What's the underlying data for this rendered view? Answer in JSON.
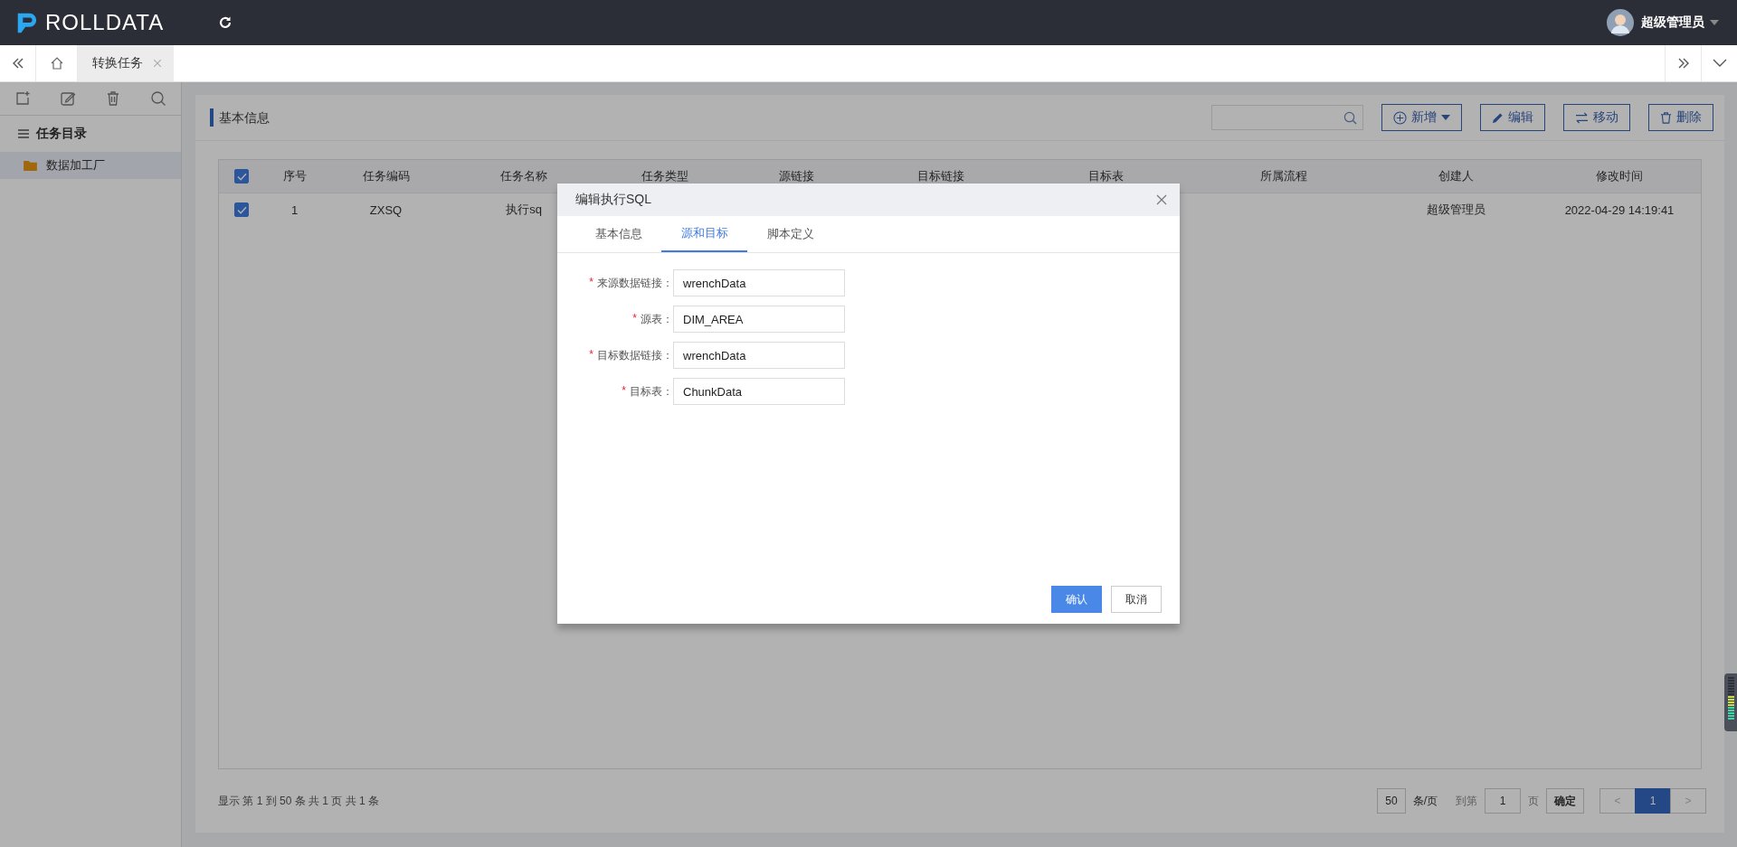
{
  "app": {
    "logo": "ROLLDATA",
    "user": "超级管理员"
  },
  "tabs": [
    {
      "label": "转换任务",
      "selected": true
    }
  ],
  "sidebar": {
    "title": "任务目录",
    "items": [
      {
        "label": "数据加工厂",
        "selected": true
      }
    ]
  },
  "panel": {
    "title": "基本信息",
    "buttons": [
      {
        "label": "新增",
        "kind": "add"
      },
      {
        "label": "编辑",
        "kind": "edit"
      },
      {
        "label": "移动",
        "kind": "move"
      },
      {
        "label": "删除",
        "kind": "delete"
      }
    ]
  },
  "table": {
    "all_checked": true,
    "columns": [
      "序号",
      "任务编码",
      "任务名称",
      "任务类型",
      "源链接",
      "目标链接",
      "目标表",
      "所属流程",
      "创建人",
      "修改时间"
    ],
    "rows": [
      {
        "checked": true,
        "index": "1",
        "code": "ZXSQ",
        "name": "执行sq",
        "creator": "超级管理员",
        "modified": "2022-04-29 14:19:41"
      }
    ]
  },
  "pagination": {
    "summary": "显示 第 1 到 50 条 共 1 页 共 1 条",
    "page_size": "50",
    "per_page_label": "条/页",
    "goto_label": "到第",
    "goto_value": "1",
    "page_label": "页",
    "confirm": "确定",
    "prev": "<",
    "next": ">",
    "prev_disabled": true,
    "next_disabled": true,
    "pages": [
      {
        "label": "1",
        "selected": true
      }
    ]
  },
  "dialog": {
    "title": "编辑执行SQL",
    "tabs": [
      {
        "label": "基本信息",
        "selected": false
      },
      {
        "label": "源和目标",
        "selected": true
      },
      {
        "label": "脚本定义",
        "selected": false
      }
    ],
    "fields": [
      {
        "required_mark": "*",
        "label": "来源数据链接：",
        "value": "wrenchData"
      },
      {
        "required_mark": "*",
        "label": "源表：",
        "value": "DIM_AREA"
      },
      {
        "required_mark": "*",
        "label": "目标数据链接：",
        "value": "wrenchData"
      },
      {
        "required_mark": "*",
        "label": "目标表：",
        "value": "ChunkData"
      }
    ],
    "buttons": [
      {
        "label": "确认",
        "kind": "primary"
      },
      {
        "label": "取消",
        "kind": "default"
      }
    ]
  }
}
